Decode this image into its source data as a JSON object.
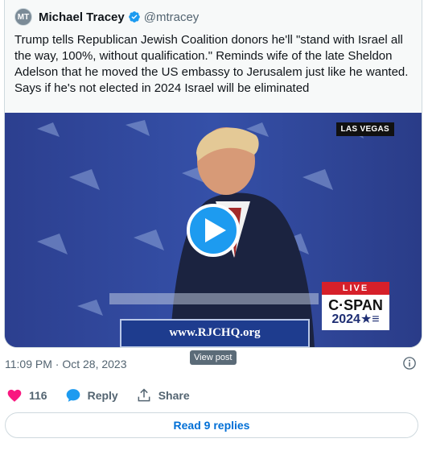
{
  "quote": {
    "author_name": "Michael Tracey",
    "handle": "@mtracey",
    "avatar_initials": "MT",
    "text": "Trump tells Republican Jewish Coalition donors he'll \"stand with Israel all the way, 100%, without qualification.\" Reminds wife of the late Sheldon Adelson that he moved the US embassy to Jerusalem just like he wanted. Says if he's not elected in 2024 Israel will be eliminated"
  },
  "media": {
    "location_tag": "LAS VEGAS",
    "live_label": "LIVE",
    "cspan_line1": "C·SPAN",
    "cspan_line2": "2024★≡",
    "podium_url": "www.RJCHQ.org",
    "tooltip": "View post"
  },
  "tweet": {
    "timestamp": "11:09 PM · Oct 28, 2023"
  },
  "actions": {
    "likes": "116",
    "reply_label": "Reply",
    "share_label": "Share"
  },
  "footer": {
    "read_replies": "Read 9 replies"
  },
  "colors": {
    "accent": "#1d9bf0",
    "like": "#f91880",
    "link": "#006fd6"
  }
}
